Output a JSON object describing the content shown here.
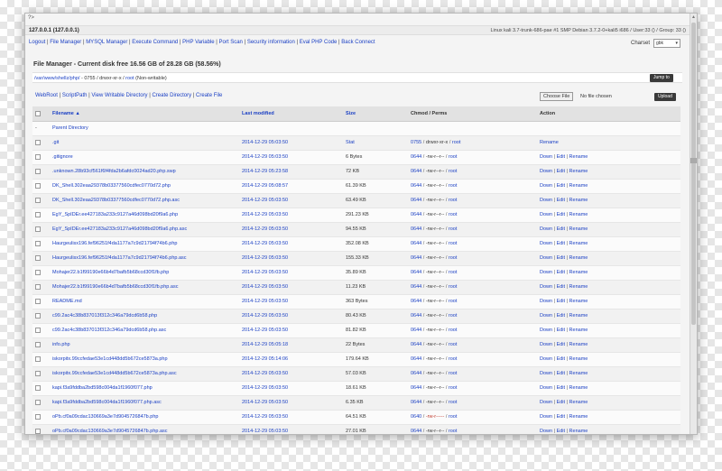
{
  "header": {
    "title_q": "?>",
    "host": "127.0.0.1 (127.0.0.1)",
    "sysinfo": "Linux kali 3.7-trunk-686-pae #1 SMP Debian 3.7.2-0+kali5 i686 / User:33 () / Group: 33 ()"
  },
  "menu": {
    "items": [
      "Logout",
      "File Manager",
      "MYSQL Manager",
      "Execute Command",
      "PHP Variable",
      "Port Scan",
      "Security information",
      "Eval PHP Code",
      "Back Connect"
    ]
  },
  "charset": {
    "label": "Charset",
    "value": "gbk"
  },
  "fm": {
    "title": "File Manager - Current disk free 16.56 GB of 28.28 GB (58.56%)",
    "path_link": "/var/www/shellz/php/",
    "path_perm": " - 0755 / drwxr-xr-x / ",
    "path_owner": "root",
    "path_note": " (Non-writable)",
    "jump_label": "Jump to"
  },
  "tools": {
    "links": [
      "WebRoot",
      "ScriptPath",
      "View Writable Directory",
      "Create Directory",
      "Create File"
    ],
    "choose_file": "Choose File",
    "no_file": "No file chosen",
    "upload_label": "Upload"
  },
  "table": {
    "headers": {
      "filename": "Filename ▲",
      "modified": "Last modified",
      "size": "Size",
      "chmod": "Chmod / Perms",
      "action": "Action"
    },
    "parent": {
      "marker": "-",
      "label": "Parent Directory"
    },
    "dir_row": {
      "name": ".git",
      "modified": "2014-12-29 05:03:50",
      "size": "Stat",
      "mode": "0755",
      "perms": "drwxr-xr-x",
      "owner": "root",
      "action": "Rename"
    },
    "rows": [
      {
        "name": ".gitignore",
        "modified": "2014-12-29 05:03:50",
        "size": "6 Bytes",
        "mode": "0644",
        "perms": "-rw-r--r--",
        "owner": "root"
      },
      {
        ".name": "",
        "name": ".unknown.28b93cf561f6f4fda2b6afdc0024ad20.php.swp",
        "modified": "2014-12-29 05:23:58",
        "size": "72 KB",
        "mode": "0644",
        "perms": "-rw-r--r--",
        "owner": "root"
      },
      {
        "name": "DK_Shell.302eaa29378b03377560cdfec0770d72.php",
        "modified": "2014-12-29 05:08:57",
        "size": "61.39 KB",
        "mode": "0644",
        "perms": "-rw-r--r--",
        "owner": "root"
      },
      {
        "name": "DK_Shell.302eaa29378b03377560cdfec0770d72.php.asc",
        "modified": "2014-12-29 05:03:50",
        "size": "63.49 KB",
        "mode": "0644",
        "perms": "-rw-r--r--",
        "owner": "root"
      },
      {
        "name": "EgY_SpIDEr.ee427183a233c9127a46d098bd20f9a6.php",
        "modified": "2014-12-29 05:03:50",
        "size": "291.23 KB",
        "mode": "0644",
        "perms": "-rw-r--r--",
        "owner": "root"
      },
      {
        "name": "EgY_SpIDEr.ee427183a233c9127a46d098bd20f9a6.php.asc",
        "modified": "2014-12-29 05:03:50",
        "size": "94.55 KB",
        "mode": "0644",
        "perms": "-rw-r--r--",
        "owner": "root"
      },
      {
        "name": "Haurgeulisx196.fef96251f4da1177a7c9d21794f74b6.php",
        "modified": "2014-12-29 05:03:50",
        "size": "352.08 KB",
        "mode": "0644",
        "perms": "-rw-r--r--",
        "owner": "root"
      },
      {
        "name": "Haurgeulisx196.fef96251f4da1177a7c9d21794f74b6.php.asc",
        "modified": "2014-12-29 05:03:50",
        "size": "155.33 KB",
        "mode": "0644",
        "perms": "-rw-r--r--",
        "owner": "root"
      },
      {
        "name": "Mohajer22.b1f99190e66b4d7bafb5b68ccd30f1fb.php",
        "modified": "2014-12-29 05:03:50",
        "size": "35.89 KB",
        "mode": "0644",
        "perms": "-rw-r--r--",
        "owner": "root"
      },
      {
        "name": "Mohajer22.b1f99190e66b4d7bafb5b68ccd30f1fb.php.asc",
        "modified": "2014-12-29 05:03:50",
        "size": "11.23 KB",
        "mode": "0644",
        "perms": "-rw-r--r--",
        "owner": "root"
      },
      {
        "name": "README.md",
        "modified": "2014-12-29 05:03:50",
        "size": "363 Bytes",
        "mode": "0644",
        "perms": "-rw-r--r--",
        "owner": "root"
      },
      {
        "name": "c99.2ac4c38b837013f312c346a79dcd6b58.php",
        "modified": "2014-12-29 05:03:50",
        "size": "80.43 KB",
        "mode": "0644",
        "perms": "-rw-r--r--",
        "owner": "root"
      },
      {
        "name": "c99.2ac4c38b837013f312c346a79dcd6b58.php.asc",
        "modified": "2014-12-29 05:03:50",
        "size": "81.82 KB",
        "mode": "0644",
        "perms": "-rw-r--r--",
        "owner": "root"
      },
      {
        "name": "info.php",
        "modified": "2014-12-29 05:05:18",
        "size": "22 Bytes",
        "mode": "0644",
        "perms": "-rw-r--r--",
        "owner": "root"
      },
      {
        "name": "iskorpitx.99ccfedae53e1cd448dd5b672ce5873a.php",
        "modified": "2014-12-29 05:14:06",
        "size": "179.64 KB",
        "mode": "0644",
        "perms": "-rw-r--r--",
        "owner": "root"
      },
      {
        "name": "iskorpitx.99ccfedae53e1cd448dd5b672ce5873a.php.asc",
        "modified": "2014-12-29 05:03:50",
        "size": "57.03 KB",
        "mode": "0644",
        "perms": "-rw-r--r--",
        "owner": "root"
      },
      {
        "name": "kapi.f3a9fddba2bd598c004da1f1960f077.php",
        "modified": "2014-12-29 05:03:50",
        "size": "18.61 KB",
        "mode": "0644",
        "perms": "-rw-r--r--",
        "owner": "root"
      },
      {
        "name": "kapi.f3a9fddba2bd598c004da1f1960f077.php.asc",
        "modified": "2014-12-29 05:03:50",
        "size": "6.35 KB",
        "mode": "0644",
        "perms": "-rw-r--r--",
        "owner": "root"
      },
      {
        "name": "oPb.cf0a09cdac130669a3e7d9045726847b.php",
        "modified": "2014-12-29 05:03:50",
        "size": "64.51 KB",
        "mode": "0640",
        "perms": "-rw-r-----",
        "owner": "root",
        "red": true
      },
      {
        "name": "oPb.cf0a09cdac130669a3e7d9045726847b.php.asc",
        "modified": "2014-12-29 05:03:50",
        "size": "27.01 KB",
        "mode": "0644",
        "perms": "-rw-r--r--",
        "owner": "root"
      }
    ],
    "action_labels": [
      "Down",
      "Edit",
      "Rename"
    ]
  },
  "colors": {
    "link": "#1a3fc4",
    "warn": "#c0392b",
    "header_bg": "#e2e2e2"
  }
}
